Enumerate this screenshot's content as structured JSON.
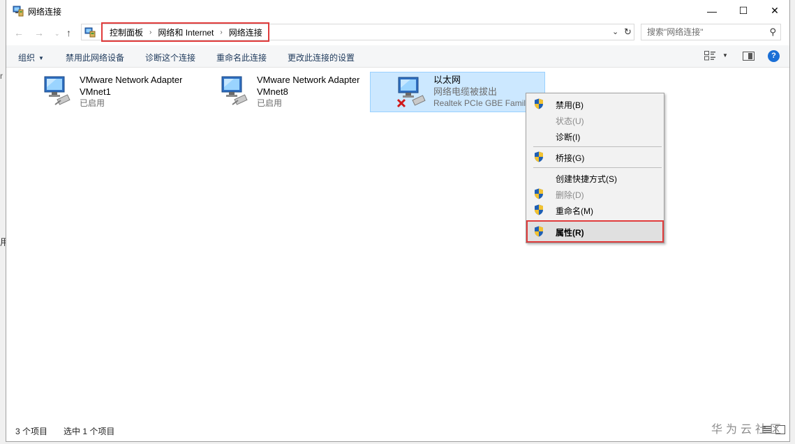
{
  "window": {
    "title": "网络连接",
    "minimize_glyph": "—",
    "maximize_glyph": "☐",
    "close_glyph": "✕"
  },
  "nav": {
    "back_glyph": "←",
    "forward_glyph": "→",
    "recent_glyph": "⌄",
    "up_glyph": "↑"
  },
  "address": {
    "crumbs": [
      "控制面板",
      "网络和 Internet",
      "网络连接"
    ],
    "separator": "›",
    "dropdown_glyph": "⌄",
    "refresh_glyph": "↻"
  },
  "search": {
    "placeholder": "搜索\"网络连接\"",
    "icon_glyph": "⚲"
  },
  "toolbar": {
    "organize": "组织",
    "organize_caret": "▼",
    "disable_device": "禁用此网络设备",
    "diagnose": "诊断这个连接",
    "rename": "重命名此连接",
    "change_settings": "更改此连接的设置",
    "view_caret": "▼",
    "help": "?"
  },
  "adapters": [
    {
      "name": "VMware Network Adapter",
      "sub": "VMnet1",
      "status": "已启用",
      "selected": false,
      "disconnected": false
    },
    {
      "name": "VMware Network Adapter",
      "sub": "VMnet8",
      "status": "已启用",
      "selected": false,
      "disconnected": false
    },
    {
      "name": "以太网",
      "sub": "网络电缆被拔出",
      "status": "Realtek PCIe GBE Family Controller",
      "selected": true,
      "disconnected": true
    }
  ],
  "context_menu": {
    "items": [
      {
        "label": "禁用(B)",
        "shield": true,
        "disabled": false
      },
      {
        "label": "状态(U)",
        "shield": false,
        "disabled": true
      },
      {
        "label": "诊断(I)",
        "shield": false,
        "disabled": false
      },
      {
        "label": "桥接(G)",
        "shield": true,
        "disabled": false
      },
      {
        "label": "创建快捷方式(S)",
        "shield": false,
        "disabled": false
      },
      {
        "label": "删除(D)",
        "shield": true,
        "disabled": true
      },
      {
        "label": "重命名(M)",
        "shield": true,
        "disabled": false
      },
      {
        "label": "属性(R)",
        "shield": true,
        "disabled": false,
        "highlighted": true
      }
    ]
  },
  "status": {
    "item_count": "3 个项目",
    "selected_count": "选中 1 个项目"
  },
  "watermark": "华为云社区",
  "edge_text": {
    "left_mid": "用",
    "left_top": "r"
  },
  "colors": {
    "highlight_border": "#e03c3c",
    "selection_fill": "#cce8ff",
    "selection_border": "#99d1ff",
    "link_text": "#1e395b",
    "help_blue": "#1a6fd6"
  }
}
